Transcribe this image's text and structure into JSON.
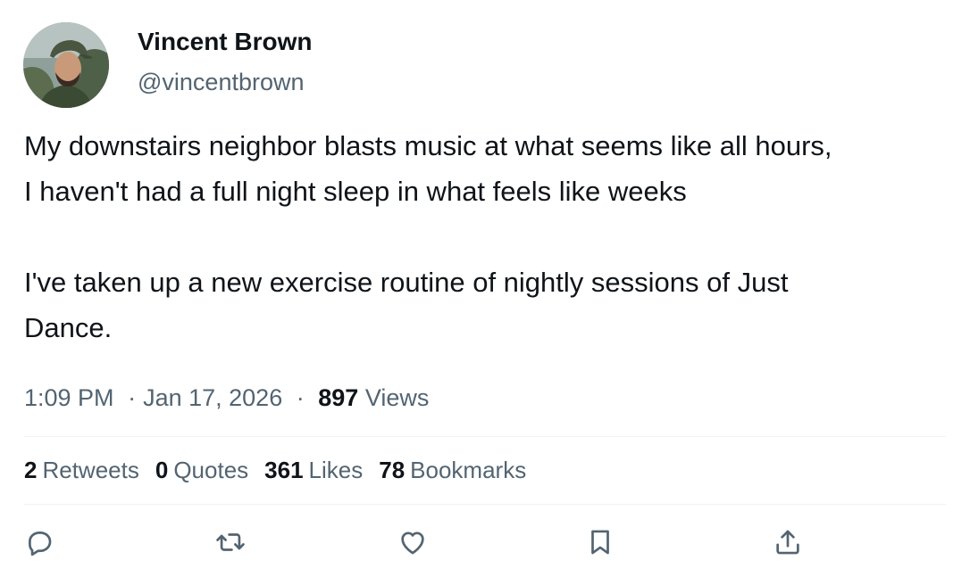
{
  "author": {
    "name": "Vincent Brown",
    "handle": "@vincentbrown"
  },
  "tweet": {
    "text": "My downstairs neighbor blasts music at what seems like all hours,\nI haven't had a full night sleep in what feels like weeks\n\nI've taken up a new exercise routine of nightly sessions of Just\nDance."
  },
  "meta": {
    "time": "1:09 PM",
    "dot": "·",
    "date": "Jan 17, 2026",
    "views_count": "897",
    "views_label": "Views"
  },
  "stats": [
    {
      "count": "2",
      "label": "Retweets"
    },
    {
      "count": "0",
      "label": "Quotes"
    },
    {
      "count": "361",
      "label": "Likes"
    },
    {
      "count": "78",
      "label": "Bookmarks"
    }
  ],
  "actions": {
    "reply_icon": "reply-icon",
    "retweet_icon": "retweet-icon",
    "like_icon": "heart-icon",
    "bookmark_icon": "bookmark-icon",
    "share_icon": "share-icon"
  },
  "colors": {
    "text": "#0f1419",
    "secondary": "#536471",
    "divider": "#eff3f4"
  }
}
